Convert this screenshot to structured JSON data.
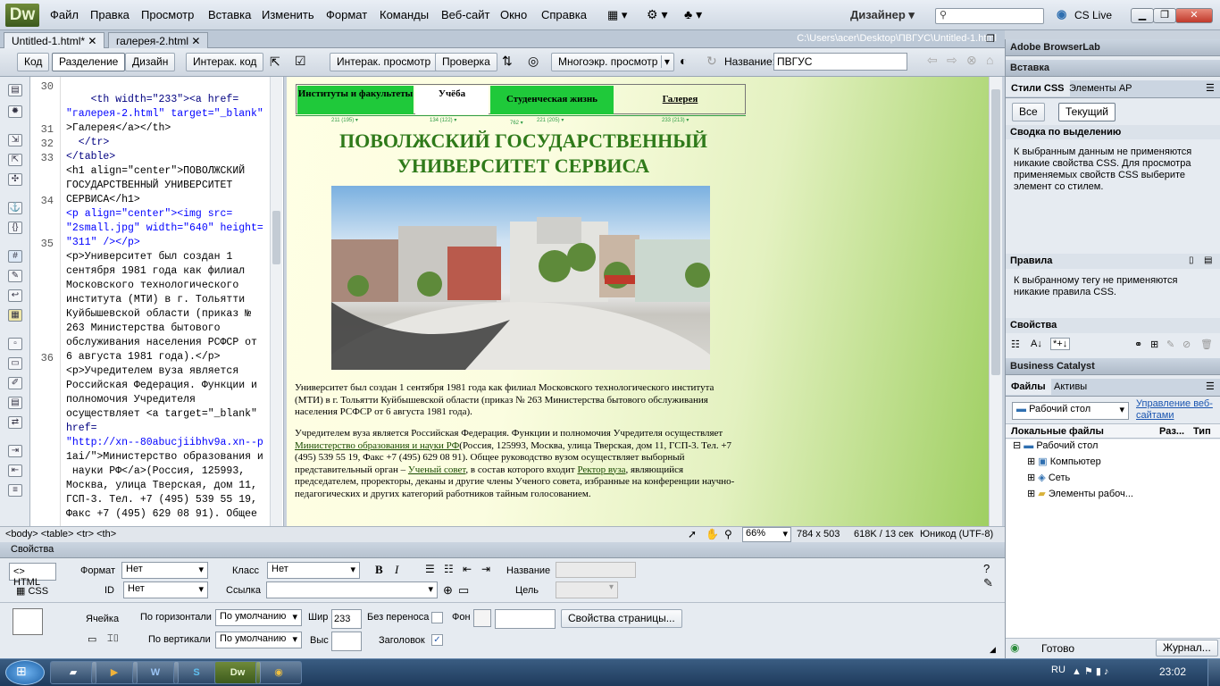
{
  "app": {
    "logo": "Dw",
    "menu": [
      "Файл",
      "Правка",
      "Просмотр",
      "Вставка",
      "Изменить",
      "Формат",
      "Команды",
      "Веб-сайт",
      "Окно",
      "Справка"
    ],
    "workspace": "Дизайнер",
    "cs_live": "CS Live",
    "window_controls": [
      "minimize-icon",
      "restore-icon",
      "close-icon"
    ]
  },
  "tabs": {
    "items": [
      "Untitled-1.html*",
      "галерея-2.html"
    ],
    "filepath": "C:\\Users\\acer\\Desktop\\ПВГУС\\Untitled-1.html"
  },
  "doc_toolbar": {
    "code": "Код",
    "split": "Разделение",
    "design": "Дизайн",
    "live_code": "Интерак. код",
    "live_view": "Интерак. просмотр",
    "check": "Проверка",
    "multiscreen": "Многоэкр. просмотр",
    "title_label": "Название:",
    "title_value": "ПВГУС"
  },
  "code": {
    "line_numbers": [
      "30",
      "31",
      "32",
      "33",
      "34",
      "35",
      "36"
    ],
    "lines": [
      "    <th width=\"233\"><a href=",
      "\"галерея-2.html\" target=\"_blank\"",
      ">Галерея</a></th>",
      "  </tr>",
      "</table>",
      "<h1 align=\"center\">ПОВОЛЖСКИЙ",
      "ГОСУДАРСТВЕННЫЙ УНИВЕРСИТЕТ",
      "СЕРВИСА</h1>",
      "<p align=\"center\"><img src=",
      "\"2small.jpg\" width=\"640\" height=",
      "\"311\" /></p>",
      "<p>Университет был создан 1",
      "сентября 1981 года как филиал",
      "Московского технологического",
      "института (МТИ) в г. Тольятти",
      "Куйбышевской области (приказ №",
      "263 Министерства бытового",
      "обслуживания населения РСФСР от",
      "6 августа 1981 года).</p>",
      "<p>Учредителем вуза является",
      "Российская Федерация. Функции и",
      "полномочия Учредителя",
      "осуществляет <a target=\"_blank\"",
      "href=",
      "\"http://xn--80abucjiibhv9a.xn--p",
      "1ai/\">Министерство образования и",
      " науки РФ</a>(Россия, 125993,",
      "Москва, улица Тверская, дом 11,",
      "ГСП-3. Тел. +7 (495) 539 55 19,",
      "Факс +7 (495) 629 08 91). Общее"
    ]
  },
  "design": {
    "nav": [
      "Институты и факультеты",
      "Учёба",
      "Студенческая жизнь",
      "Галерея"
    ],
    "ruler": [
      "211 (195) ▾",
      "134 (122) ▾",
      "762 ▾",
      "221 (205) ▾",
      "233 (213) ▾"
    ],
    "title_line1": "ПОВОЛЖСКИЙ ГОСУДАРСТВЕННЫЙ",
    "title_line2": "УНИВЕРСИТЕТ СЕРВИСА",
    "para1": "Университет был создан 1 сентября 1981 года как филиал Московского технологического института (МТИ) в г. Тольятти Куйбышевской области (приказ № 263 Министерства бытового обслуживания населения РСФСР от 6 августа 1981 года).",
    "para2_a": "Учредителем вуза является Российская Федерация. Функции и полномочия Учредителя осуществляет ",
    "para2_link1": "Министерство образования и науки РФ",
    "para2_b": "(Россия, 125993, Москва, улица Тверская, дом 11, ГСП-3. Тел. +7 (495) 539 55 19, Факс +7 (495) 629 08 91). Общее руководство вузом осуществляет выборный представительный орган – ",
    "para2_link2": "Ученый совет",
    "para2_c": ", в состав которого входит ",
    "para2_link3": "Ректор вуза",
    "para2_d": ", являющийся председателем, проректоры, деканы и другие члены Ученого совета, избранные на конференции научно-педагогических и других категорий работников тайным голосованием."
  },
  "status": {
    "tags": "<body> <table> <tr> <th>",
    "zoom": "66%",
    "size": "784 x 503",
    "weight": "618K / 13 сек",
    "encoding": "Юникод (UTF-8)"
  },
  "properties": {
    "title": "Свойства",
    "html": "HTML",
    "css": "CSS",
    "format_label": "Формат",
    "format_value": "Нет",
    "class_label": "Класс",
    "class_value": "Нет",
    "id_label": "ID",
    "id_value": "Нет",
    "link_label": "Ссылка",
    "name_label": "Название",
    "target_label": "Цель",
    "cell_label": "Ячейка",
    "horiz_label": "По горизонтали",
    "horiz_value": "По умолчанию",
    "vert_label": "По вертикали",
    "vert_value": "По умолчанию",
    "width_label": "Шир",
    "width_value": "233",
    "height_label": "Выс",
    "nowrap_label": "Без переноса",
    "bg_label": "Фон",
    "header_label": "Заголовок",
    "page_props": "Свойства страницы..."
  },
  "right_panel": {
    "browserlab": "Adobe BrowserLab",
    "insert": "Вставка",
    "css_styles": "Стили CSS",
    "ap_elements": "Элементы AP",
    "all": "Все",
    "current": "Текущий",
    "summary_title": "Сводка по выделению",
    "summary_text": "К выбранным данным не применяются никакие свойства CSS.  Для просмотра применяемых свойств CSS выберите элемент со стилем.",
    "rules_title": "Правила",
    "rules_text": "К выбранному тегу не применяются никакие правила CSS.",
    "props_title": "Свойства",
    "business_catalyst": "Business Catalyst",
    "files": "Файлы",
    "assets": "Активы",
    "site_select": "Рабочий стол",
    "manage_sites": "Управление веб-сайтами",
    "col_local": "Локальные файлы",
    "col_size": "Раз...",
    "col_type": "Тип",
    "tree": [
      "Рабочий стол",
      "Компьютер",
      "Сеть",
      "Элементы рабоч..."
    ],
    "ready": "Готово",
    "log": "Журнал..."
  },
  "taskbar": {
    "lang": "RU",
    "time": "23:02",
    "apps": [
      "explorer-icon",
      "media-icon",
      "word-icon",
      "skype-icon",
      "dreamweaver-icon",
      "chrome-icon"
    ]
  }
}
